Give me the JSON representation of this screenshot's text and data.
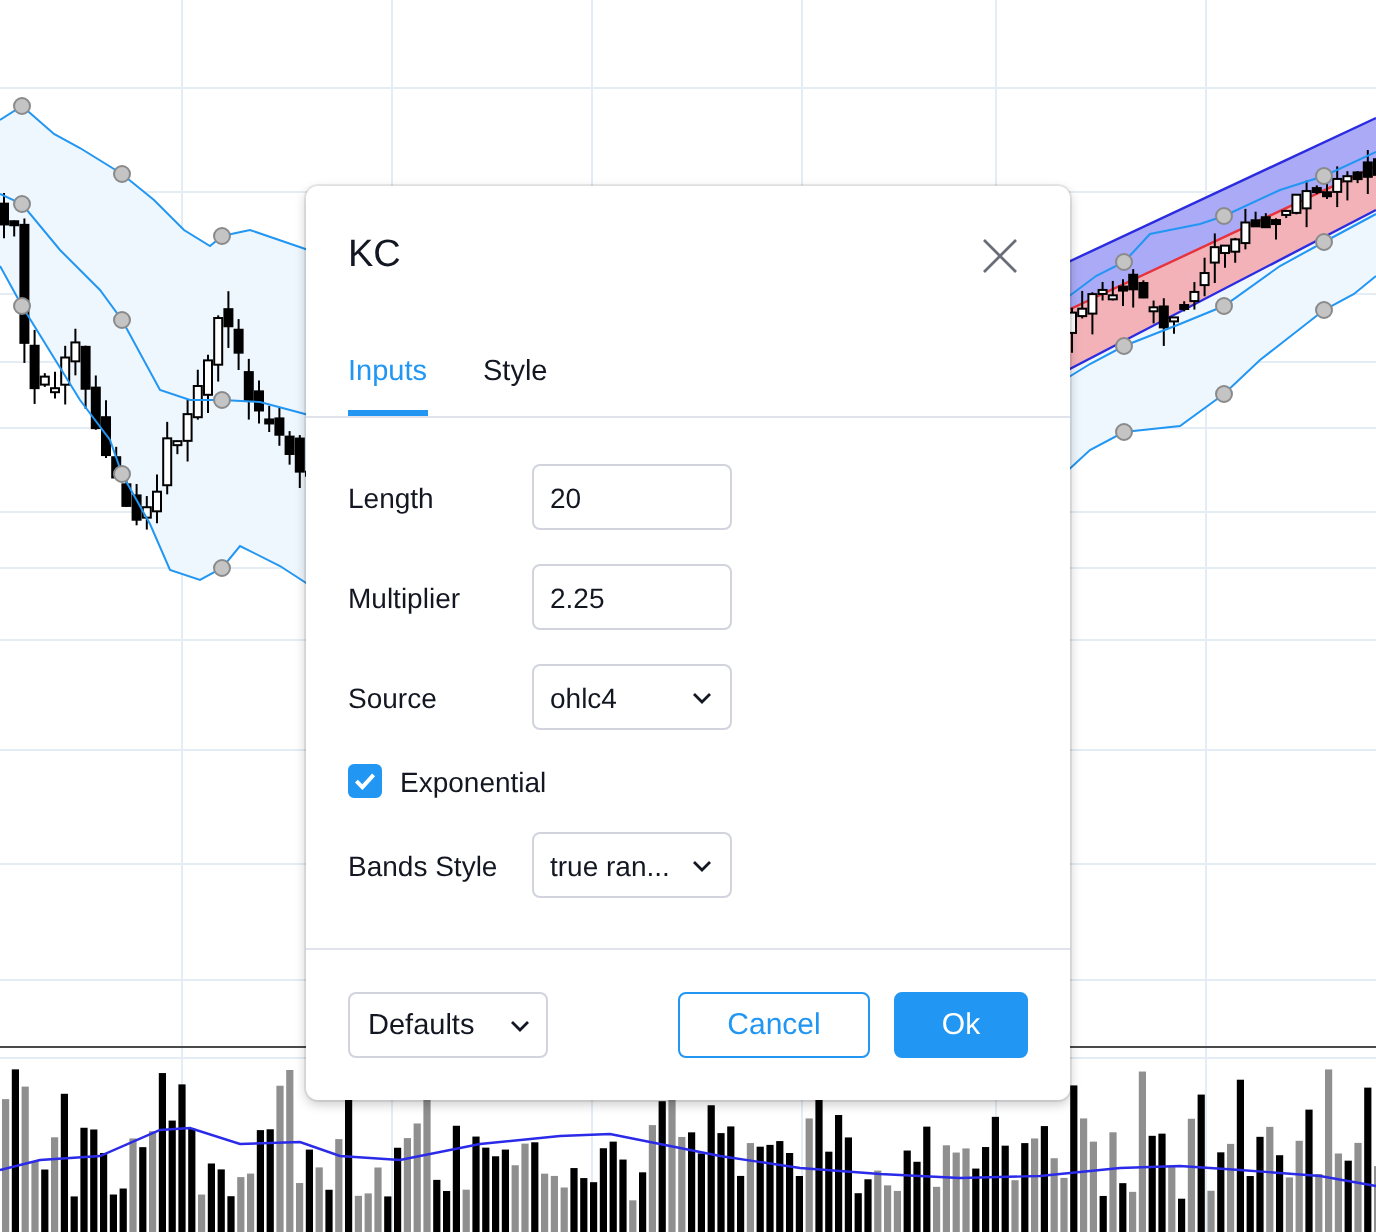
{
  "dialog": {
    "title": "KC",
    "tabs": [
      {
        "label": "Inputs",
        "selected": true
      },
      {
        "label": "Style",
        "selected": false
      }
    ],
    "fields": [
      {
        "kind": "input",
        "label": "Length",
        "value": "20"
      },
      {
        "kind": "input",
        "label": "Multiplier",
        "value": "2.25"
      },
      {
        "kind": "select",
        "label": "Source",
        "value": "ohlc4"
      },
      {
        "kind": "checkbox",
        "label": "Exponential",
        "checked": true
      },
      {
        "kind": "select",
        "label": "Bands Style",
        "value": "true ran..."
      }
    ],
    "footer": {
      "defaults": "Defaults",
      "buttons": [
        {
          "kind": "outline",
          "label": "Cancel"
        },
        {
          "kind": "filled",
          "label": "Ok"
        }
      ]
    }
  }
}
